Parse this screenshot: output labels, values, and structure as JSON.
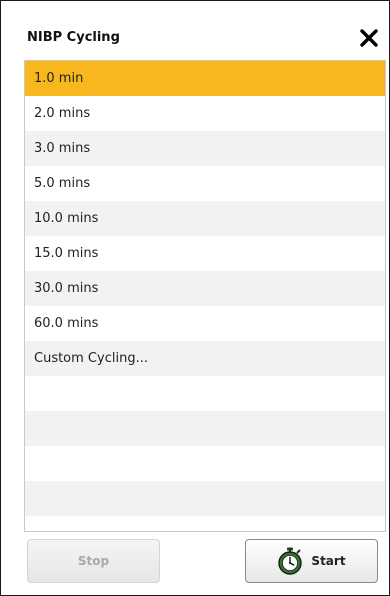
{
  "dialog": {
    "title": "NIBP Cycling",
    "close_icon": "close-icon"
  },
  "list": {
    "items": [
      {
        "label": "1.0 min",
        "selected": true
      },
      {
        "label": "2.0 mins",
        "selected": false
      },
      {
        "label": "3.0 mins",
        "selected": false
      },
      {
        "label": "5.0 mins",
        "selected": false
      },
      {
        "label": "10.0 mins",
        "selected": false
      },
      {
        "label": "15.0 mins",
        "selected": false
      },
      {
        "label": "30.0 mins",
        "selected": false
      },
      {
        "label": "60.0 mins",
        "selected": false
      },
      {
        "label": "Custom Cycling...",
        "selected": false
      }
    ]
  },
  "footer": {
    "stop_label": "Stop",
    "start_label": "Start",
    "start_icon": "stopwatch-icon"
  },
  "colors": {
    "selected_row": "#f8b81d",
    "alt_row": "#f2f2f2",
    "disabled_text": "#a9a9a9"
  }
}
